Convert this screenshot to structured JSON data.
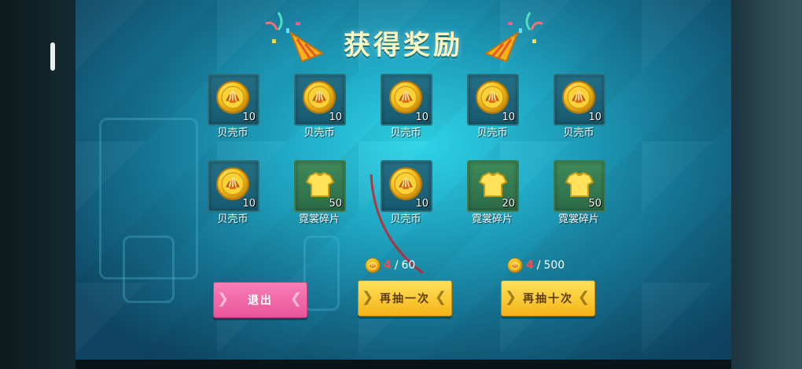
{
  "title": "获得奖励",
  "rewards_row1": [
    {
      "kind": "coin",
      "icon": "shell-coin-icon",
      "count": "10",
      "label": "贝壳币"
    },
    {
      "kind": "coin",
      "icon": "shell-coin-icon",
      "count": "10",
      "label": "贝壳币"
    },
    {
      "kind": "coin",
      "icon": "shell-coin-icon",
      "count": "10",
      "label": "贝壳币"
    },
    {
      "kind": "coin",
      "icon": "shell-coin-icon",
      "count": "10",
      "label": "贝壳币"
    },
    {
      "kind": "coin",
      "icon": "shell-coin-icon",
      "count": "10",
      "label": "贝壳币"
    }
  ],
  "rewards_row2": [
    {
      "kind": "coin",
      "icon": "shell-coin-icon",
      "count": "10",
      "label": "贝壳币"
    },
    {
      "kind": "shirt",
      "icon": "costume-shard-icon",
      "count": "50",
      "label": "霓裳碎片"
    },
    {
      "kind": "coin",
      "icon": "shell-coin-icon",
      "count": "10",
      "label": "贝壳币"
    },
    {
      "kind": "shirt",
      "icon": "costume-shard-icon",
      "count": "20",
      "label": "霓裳碎片"
    },
    {
      "kind": "shirt",
      "icon": "costume-shard-icon",
      "count": "50",
      "label": "霓裳碎片"
    }
  ],
  "single_draw": {
    "have": "4",
    "sep": "/",
    "cost": "60",
    "button": "再抽一次"
  },
  "ten_draw": {
    "have": "4",
    "sep": "/",
    "cost": "500",
    "button": "再抽十次"
  },
  "exit_button": "退出",
  "colors": {
    "accent_gold": "#f4b417",
    "exit_pink": "#e9559a",
    "insufficient_red": "#ff4a4a"
  }
}
